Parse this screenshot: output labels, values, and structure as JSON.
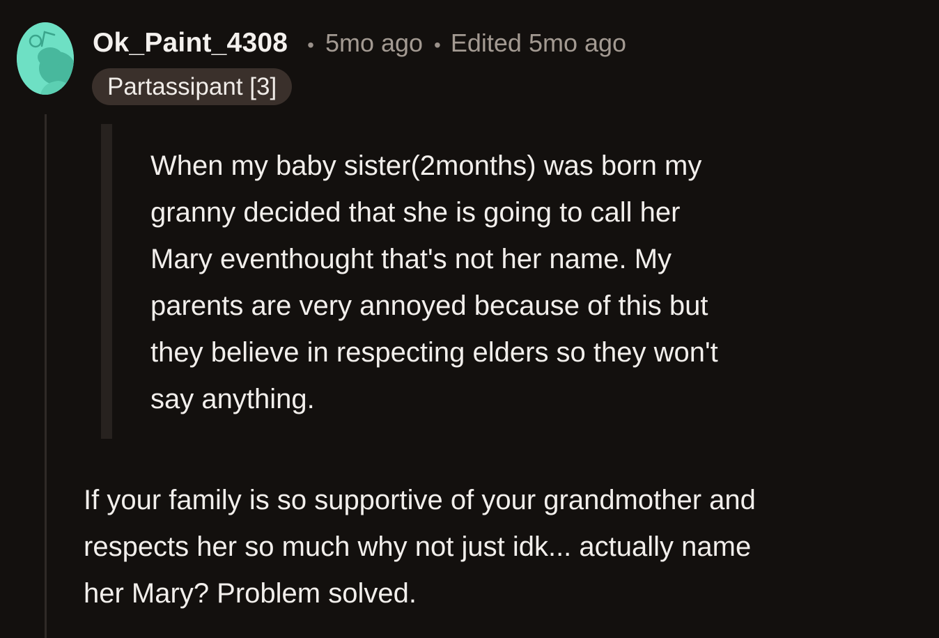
{
  "comment": {
    "username": "Ok_Paint_4308",
    "separator": "•",
    "time_ago": "5mo ago",
    "edited": "Edited 5mo ago",
    "flair": "Partassipant [3]",
    "avatar_icon": "snoo-avatar-icon",
    "colors": {
      "background": "#13100e",
      "avatar": "#6ee0c4",
      "flair_bg": "#3a302b",
      "muted_text": "#a39a92"
    },
    "quote_lines": [
      "When my baby sister(2months) was born my",
      "granny decided that she is going to call her",
      "Mary eventhought that's not her name. My",
      "parents are very annoyed because of this but",
      "they believe in respecting elders so they won't",
      "say anything."
    ],
    "reply_lines": [
      "If your family is so supportive of your grandmother and",
      "respects her so much why not just idk... actually name",
      "her Mary? Problem solved."
    ]
  }
}
